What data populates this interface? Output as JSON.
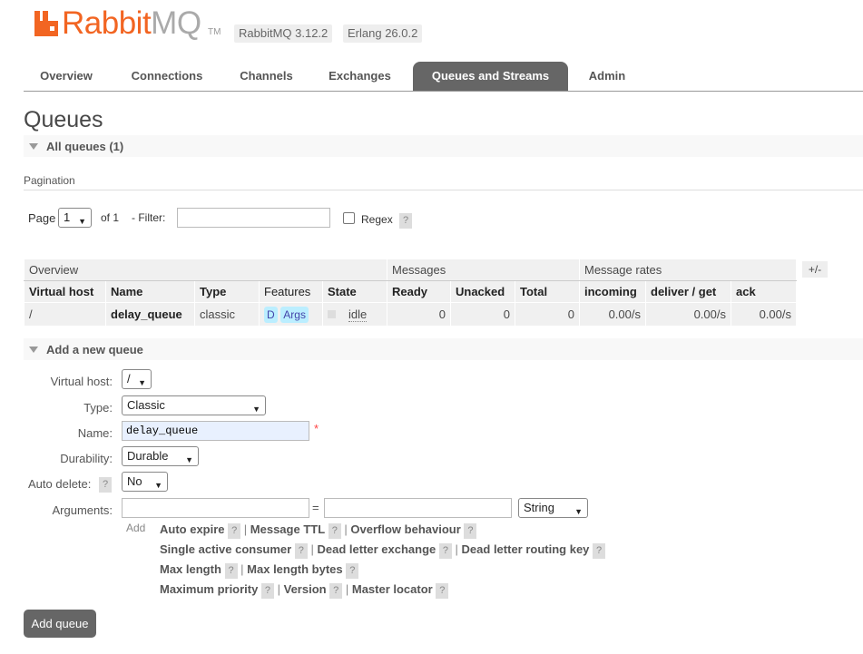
{
  "header": {
    "logo_rabbit": "Rabbit",
    "logo_mq": "MQ",
    "logo_tm": "TM",
    "version_rabbit": "RabbitMQ 3.12.2",
    "version_erlang": "Erlang 26.0.2"
  },
  "tabs": [
    {
      "label": "Overview"
    },
    {
      "label": "Connections"
    },
    {
      "label": "Channels"
    },
    {
      "label": "Exchanges"
    },
    {
      "label": "Queues and Streams"
    },
    {
      "label": "Admin"
    }
  ],
  "page_title": "Queues",
  "all_queues_label": "All queues (1)",
  "pagination": {
    "title": "Pagination",
    "page_label": "Page",
    "page_value": "1",
    "of_label": "of 1",
    "filter_label": "- Filter:",
    "filter_value": "",
    "regex_label": "Regex",
    "help": "?"
  },
  "table": {
    "groups": [
      "Overview",
      "Messages",
      "Message rates"
    ],
    "toggle_label": "+/-",
    "columns": [
      "Virtual host",
      "Name",
      "Type",
      "Features",
      "State",
      "Ready",
      "Unacked",
      "Total",
      "incoming",
      "deliver / get",
      "ack"
    ],
    "rows": [
      {
        "vhost": "/",
        "name": "delay_queue",
        "type": "classic",
        "feature_d": "D",
        "feature_args": "Args",
        "state": "idle",
        "ready": "0",
        "unacked": "0",
        "total": "0",
        "incoming": "0.00/s",
        "deliver": "0.00/s",
        "ack": "0.00/s"
      }
    ]
  },
  "add_queue": {
    "section_label": "Add a new queue",
    "vhost_label": "Virtual host:",
    "vhost_value": "/",
    "type_label": "Type:",
    "type_value": "Classic",
    "name_label": "Name:",
    "name_value": "delay_queue",
    "required_mark": "*",
    "durability_label": "Durability:",
    "durability_value": "Durable",
    "auto_delete_label": "Auto delete:",
    "auto_delete_value": "No",
    "arguments_label": "Arguments:",
    "equals": "=",
    "arg_type_value": "String",
    "add_label": "Add",
    "arg_links": {
      "auto_expire": "Auto expire",
      "message_ttl": "Message TTL",
      "overflow": "Overflow behaviour",
      "single_active": "Single active consumer",
      "dlx": "Dead letter exchange",
      "dlrk": "Dead letter routing key",
      "max_length": "Max length",
      "max_length_bytes": "Max length bytes",
      "max_priority": "Maximum priority",
      "version": "Version",
      "master_locator": "Master locator"
    },
    "sep": "|",
    "submit_label": "Add queue"
  }
}
